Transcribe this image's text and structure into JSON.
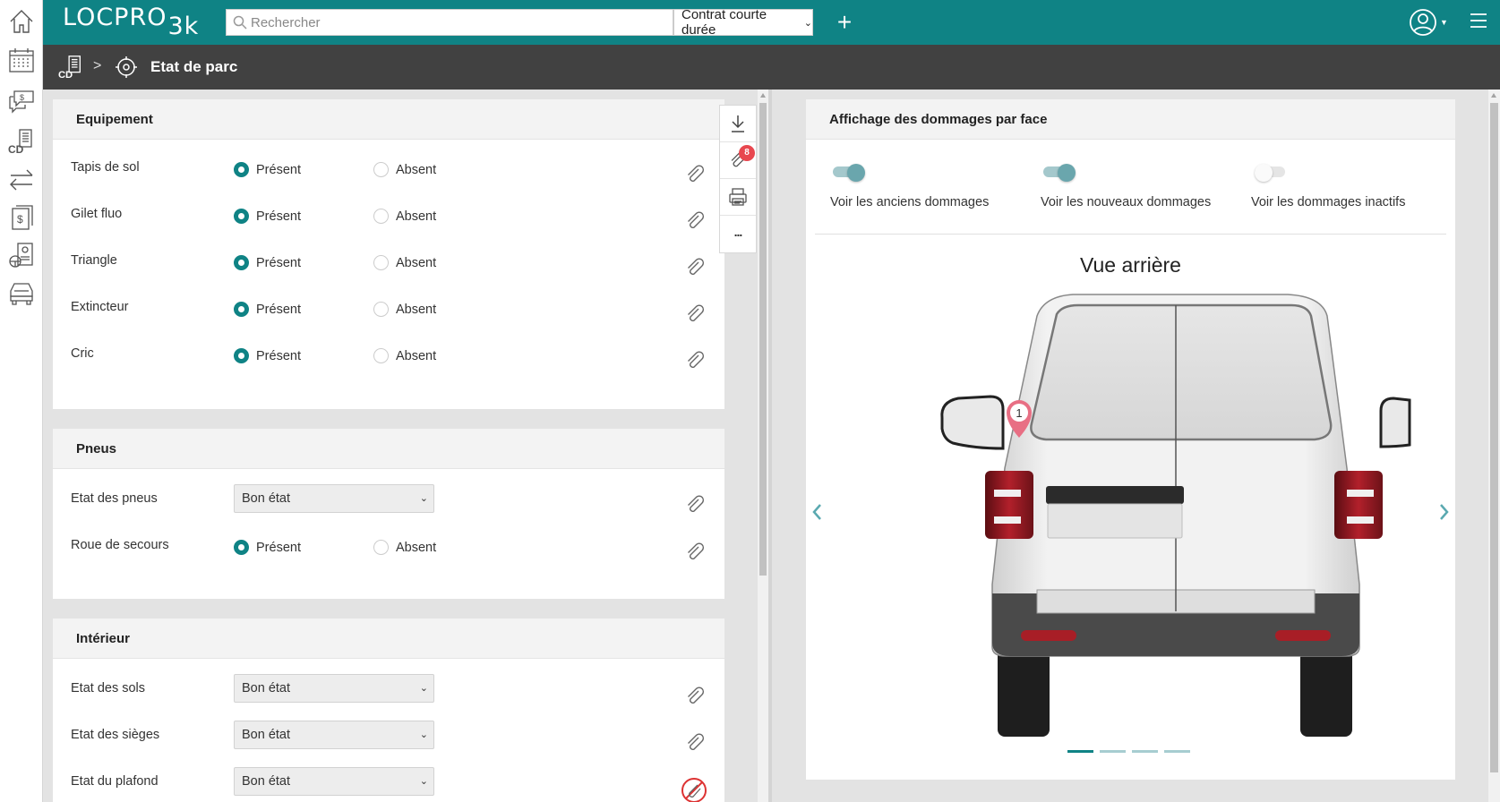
{
  "app": {
    "logo": "LOCPRO",
    "logo_suffix": "3k"
  },
  "topbar": {
    "search_placeholder": "Rechercher",
    "contract_type": "Contrat courte durée",
    "add_icon": "plus-icon",
    "user_icon": "user-circle-icon",
    "menu_icon": "hamburger-icon"
  },
  "rail": {
    "items": [
      "home-icon",
      "calendar-icon",
      "quote-icon",
      "contract-icon",
      "transfer-icon",
      "invoice-icon",
      "driver-icon",
      "vehicle-icon"
    ]
  },
  "breadcrumb": {
    "root_icon": "contract-icon",
    "separator": ">",
    "page_icon": "target-icon",
    "title": "Etat de parc"
  },
  "equipement": {
    "title": "Equipement",
    "rows": [
      {
        "label": "Tapis de sol",
        "present": "Présent",
        "absent": "Absent",
        "selected": "Présent"
      },
      {
        "label": "Gilet fluo",
        "present": "Présent",
        "absent": "Absent",
        "selected": "Présent"
      },
      {
        "label": "Triangle",
        "present": "Présent",
        "absent": "Absent",
        "selected": "Présent"
      },
      {
        "label": "Extincteur",
        "present": "Présent",
        "absent": "Absent",
        "selected": "Présent"
      },
      {
        "label": "Cric",
        "present": "Présent",
        "absent": "Absent",
        "selected": "Présent"
      }
    ]
  },
  "pneus": {
    "title": "Pneus",
    "etat_label": "Etat des pneus",
    "etat_value": "Bon état",
    "roue_label": "Roue de secours",
    "roue_present": "Présent",
    "roue_absent": "Absent",
    "roue_selected": "Présent"
  },
  "interieur": {
    "title": "Intérieur",
    "rows": [
      {
        "label": "Etat des sols",
        "value": "Bon état"
      },
      {
        "label": "Etat des sièges",
        "value": "Bon état"
      },
      {
        "label": "Etat du plafond",
        "value": "Bon état"
      }
    ]
  },
  "toolbar": {
    "items": [
      "download-icon",
      "attachment-icon",
      "print-icon",
      "more-icon"
    ],
    "attachment_count": "8",
    "more_label": "..."
  },
  "dommages": {
    "title": "Affichage des dommages par face",
    "toggles": [
      {
        "label": "Voir les anciens dommages",
        "on": true
      },
      {
        "label": "Voir les nouveaux dommages",
        "on": true
      },
      {
        "label": "Voir les dommages inactifs",
        "on": false
      }
    ],
    "view_title": "Vue arrière",
    "marker_number": "1",
    "slide_count": 4,
    "active_slide": 1,
    "accent_color": "#0f8385",
    "marker_color": "#e86f84"
  }
}
